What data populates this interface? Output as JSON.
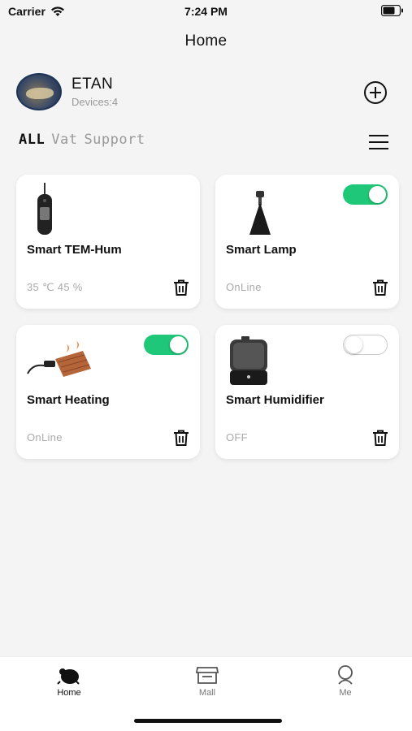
{
  "status_bar": {
    "carrier": "Carrier",
    "time": "7:24 PM"
  },
  "nav": {
    "title": "Home"
  },
  "profile": {
    "name": "ETAN",
    "devices": "Devices:4"
  },
  "tabs": [
    {
      "label": "ALL",
      "active": true
    },
    {
      "label": "Vat",
      "active": false
    },
    {
      "label": "Support",
      "active": false
    }
  ],
  "devices": [
    {
      "name": "Smart TEM-Hum",
      "status": "35 ℃   45 %",
      "icon": "thermo-hygrometer-image"
    },
    {
      "name": "Smart Lamp",
      "status": "OnLine",
      "toggle_on": true,
      "icon": "lamp-image"
    },
    {
      "name": "Smart Heating",
      "status": "OnLine",
      "toggle_on": true,
      "icon": "heating-mat-image"
    },
    {
      "name": "Smart Humidifier",
      "status": "OFF",
      "toggle_on": false,
      "icon": "humidifier-image"
    }
  ],
  "tab_bar": {
    "items": [
      {
        "label": "Home",
        "icon": "home-icon",
        "active": true
      },
      {
        "label": "Mall",
        "icon": "mall-icon",
        "active": false
      },
      {
        "label": "Me",
        "icon": "me-icon",
        "active": false
      }
    ]
  },
  "colors": {
    "accent_green": "#1fc878",
    "background": "#f4f4f4",
    "muted_text": "#999999"
  }
}
